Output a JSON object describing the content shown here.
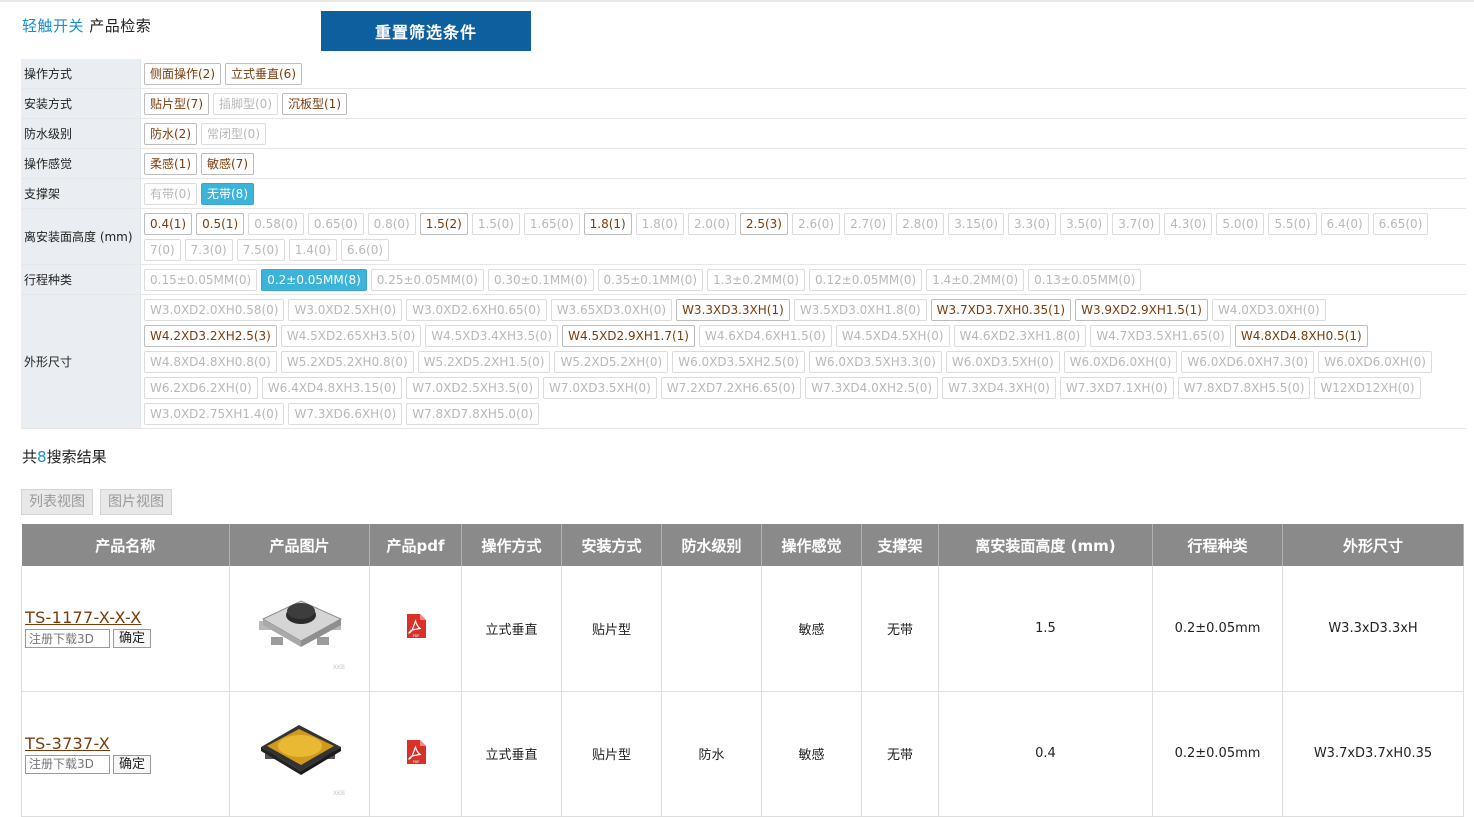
{
  "breadcrumb": {
    "category": "轻触开关",
    "page": "产品检索"
  },
  "reset_button": "重置筛选条件",
  "filters": [
    {
      "label": "操作方式",
      "options": [
        {
          "text": "侧面操作(2)",
          "state": "on"
        },
        {
          "text": "立式垂直(6)",
          "state": "on"
        }
      ]
    },
    {
      "label": "安装方式",
      "options": [
        {
          "text": "贴片型(7)",
          "state": "on"
        },
        {
          "text": "插脚型(0)",
          "state": "off"
        },
        {
          "text": "沉板型(1)",
          "state": "on"
        }
      ]
    },
    {
      "label": "防水级别",
      "options": [
        {
          "text": "防水(2)",
          "state": "on"
        },
        {
          "text": "常闭型(0)",
          "state": "off"
        }
      ]
    },
    {
      "label": "操作感觉",
      "options": [
        {
          "text": "柔感(1)",
          "state": "on"
        },
        {
          "text": "敏感(7)",
          "state": "on"
        }
      ]
    },
    {
      "label": "支撑架",
      "options": [
        {
          "text": "有带(0)",
          "state": "off"
        },
        {
          "text": "无带(8)",
          "state": "sel"
        }
      ]
    },
    {
      "label": "离安装面高度 (mm)",
      "options": [
        {
          "text": "0.4(1)",
          "state": "on"
        },
        {
          "text": "0.5(1)",
          "state": "on"
        },
        {
          "text": "0.58(0)",
          "state": "off"
        },
        {
          "text": "0.65(0)",
          "state": "off"
        },
        {
          "text": "0.8(0)",
          "state": "off"
        },
        {
          "text": "1.5(2)",
          "state": "on"
        },
        {
          "text": "1.5(0)",
          "state": "off"
        },
        {
          "text": "1.65(0)",
          "state": "off"
        },
        {
          "text": "1.8(1)",
          "state": "on"
        },
        {
          "text": "1.8(0)",
          "state": "off"
        },
        {
          "text": "2.0(0)",
          "state": "off"
        },
        {
          "text": "2.5(3)",
          "state": "on"
        },
        {
          "text": "2.6(0)",
          "state": "off"
        },
        {
          "text": "2.7(0)",
          "state": "off"
        },
        {
          "text": "2.8(0)",
          "state": "off"
        },
        {
          "text": "3.15(0)",
          "state": "off"
        },
        {
          "text": "3.3(0)",
          "state": "off"
        },
        {
          "text": "3.5(0)",
          "state": "off"
        },
        {
          "text": "3.7(0)",
          "state": "off"
        },
        {
          "text": "4.3(0)",
          "state": "off"
        },
        {
          "text": "5.0(0)",
          "state": "off"
        },
        {
          "text": "5.5(0)",
          "state": "off"
        },
        {
          "text": "6.4(0)",
          "state": "off"
        },
        {
          "text": "6.65(0)",
          "state": "off"
        },
        {
          "text": "7(0)",
          "state": "off"
        },
        {
          "text": "7.3(0)",
          "state": "off"
        },
        {
          "text": "7.5(0)",
          "state": "off"
        },
        {
          "text": "1.4(0)",
          "state": "off"
        },
        {
          "text": "6.6(0)",
          "state": "off"
        }
      ]
    },
    {
      "label": "行程种类",
      "options": [
        {
          "text": "0.15±0.05MM(0)",
          "state": "off"
        },
        {
          "text": "0.2±0.05MM(8)",
          "state": "sel"
        },
        {
          "text": "0.25±0.05MM(0)",
          "state": "off"
        },
        {
          "text": "0.30±0.1MM(0)",
          "state": "off"
        },
        {
          "text": "0.35±0.1MM(0)",
          "state": "off"
        },
        {
          "text": "1.3±0.2MM(0)",
          "state": "off"
        },
        {
          "text": "0.12±0.05MM(0)",
          "state": "off"
        },
        {
          "text": "1.4±0.2MM(0)",
          "state": "off"
        },
        {
          "text": "0.13±0.05MM(0)",
          "state": "off"
        }
      ]
    },
    {
      "label": "外形尺寸",
      "options": [
        {
          "text": "W3.0XD2.0XH0.58(0)",
          "state": "off"
        },
        {
          "text": "W3.0XD2.5XH(0)",
          "state": "off"
        },
        {
          "text": "W3.0XD2.6XH0.65(0)",
          "state": "off"
        },
        {
          "text": "W3.65XD3.0XH(0)",
          "state": "off"
        },
        {
          "text": "W3.3XD3.3XH(1)",
          "state": "on"
        },
        {
          "text": "W3.5XD3.0XH1.8(0)",
          "state": "off"
        },
        {
          "text": "W3.7XD3.7XH0.35(1)",
          "state": "on"
        },
        {
          "text": "W3.9XD2.9XH1.5(1)",
          "state": "on"
        },
        {
          "text": "W4.0XD3.0XH(0)",
          "state": "off"
        },
        {
          "text": "W4.2XD3.2XH2.5(3)",
          "state": "on"
        },
        {
          "text": "W4.5XD2.65XH3.5(0)",
          "state": "off"
        },
        {
          "text": "W4.5XD3.4XH3.5(0)",
          "state": "off"
        },
        {
          "text": "W4.5XD2.9XH1.7(1)",
          "state": "on"
        },
        {
          "text": "W4.6XD4.6XH1.5(0)",
          "state": "off"
        },
        {
          "text": "W4.5XD4.5XH(0)",
          "state": "off"
        },
        {
          "text": "W4.6XD2.3XH1.8(0)",
          "state": "off"
        },
        {
          "text": "W4.7XD3.5XH1.65(0)",
          "state": "off"
        },
        {
          "text": "W4.8XD4.8XH0.5(1)",
          "state": "on"
        },
        {
          "text": "W4.8XD4.8XH0.8(0)",
          "state": "off"
        },
        {
          "text": "W5.2XD5.2XH0.8(0)",
          "state": "off"
        },
        {
          "text": "W5.2XD5.2XH1.5(0)",
          "state": "off"
        },
        {
          "text": "W5.2XD5.2XH(0)",
          "state": "off"
        },
        {
          "text": "W6.0XD3.5XH2.5(0)",
          "state": "off"
        },
        {
          "text": "W6.0XD3.5XH3.3(0)",
          "state": "off"
        },
        {
          "text": "W6.0XD3.5XH(0)",
          "state": "off"
        },
        {
          "text": "W6.0XD6.0XH(0)",
          "state": "off"
        },
        {
          "text": "W6.0XD6.0XH7.3(0)",
          "state": "off"
        },
        {
          "text": "W6.0XD6.0XH(0)",
          "state": "off"
        },
        {
          "text": "W6.2XD6.2XH(0)",
          "state": "off"
        },
        {
          "text": "W6.4XD4.8XH3.15(0)",
          "state": "off"
        },
        {
          "text": "W7.0XD2.5XH3.5(0)",
          "state": "off"
        },
        {
          "text": "W7.0XD3.5XH(0)",
          "state": "off"
        },
        {
          "text": "W7.2XD7.2XH6.65(0)",
          "state": "off"
        },
        {
          "text": "W7.3XD4.0XH2.5(0)",
          "state": "off"
        },
        {
          "text": "W7.3XD4.3XH(0)",
          "state": "off"
        },
        {
          "text": "W7.3XD7.1XH(0)",
          "state": "off"
        },
        {
          "text": "W7.8XD7.8XH5.5(0)",
          "state": "off"
        },
        {
          "text": "W12XD12XH(0)",
          "state": "off"
        },
        {
          "text": "W3.0XD2.75XH1.4(0)",
          "state": "off"
        },
        {
          "text": "W7.3XD6.6XH(0)",
          "state": "off"
        },
        {
          "text": "W7.8XD7.8XH5.0(0)",
          "state": "off"
        }
      ]
    }
  ],
  "results": {
    "prefix": "共",
    "count": "8",
    "suffix": "搜索结果"
  },
  "views": {
    "list": "列表视图",
    "grid": "图片视图"
  },
  "table": {
    "headers": [
      "产品名称",
      "产品图片",
      "产品pdf",
      "操作方式",
      "安装方式",
      "防水级别",
      "操作感觉",
      "支撑架",
      "离安装面高度 (mm)",
      "行程种类",
      "外形尺寸"
    ],
    "download_placeholder": "注册下载3D",
    "confirm_label": "确定",
    "rows": [
      {
        "name": "TS-1177-X-X-X",
        "image": "metal-tact-switch",
        "op": "立式垂直",
        "mount": "贴片型",
        "water": "",
        "feel": "敏感",
        "bracket": "无带",
        "height": "1.5",
        "stroke": "0.2±0.05mm",
        "size": "W3.3xD3.3xH"
      },
      {
        "name": "TS-3737-X",
        "image": "amber-dome-switch",
        "op": "立式垂直",
        "mount": "贴片型",
        "water": "防水",
        "feel": "敏感",
        "bracket": "无带",
        "height": "0.4",
        "stroke": "0.2±0.05mm",
        "size": "W3.7xD3.7xH0.35"
      }
    ]
  },
  "colors": {
    "accent": "#1a8fd0",
    "reset_bg": "#0d5f9e",
    "selected": "#3cb4d9",
    "header_bg": "#8a8a8a",
    "active_text": "#7a3b0c",
    "pdf_red": "#d9302a"
  }
}
